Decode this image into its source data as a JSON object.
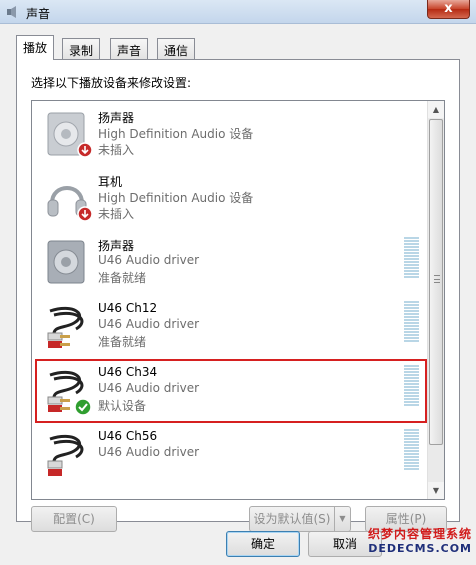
{
  "window": {
    "title": "声音",
    "close_label": "x"
  },
  "tabs": [
    {
      "label": "播放",
      "active": true
    },
    {
      "label": "录制",
      "active": false
    },
    {
      "label": "声音",
      "active": false
    },
    {
      "label": "通信",
      "active": false
    }
  ],
  "playback": {
    "instruction": "选择以下播放设备来修改设置:",
    "devices": [
      {
        "name": "扬声器",
        "description": "High Definition Audio 设备",
        "status": "未插入",
        "icon": "speaker-icon",
        "badge": "unplugged",
        "meter": false
      },
      {
        "name": "耳机",
        "description": "High Definition Audio 设备",
        "status": "未插入",
        "icon": "headphones-icon",
        "badge": "unplugged",
        "meter": false
      },
      {
        "name": "扬声器",
        "description": "U46 Audio driver",
        "status": "准备就绪",
        "icon": "speaker-icon",
        "badge": "none",
        "meter": true
      },
      {
        "name": "U46 Ch12",
        "description": "U46 Audio driver",
        "status": "准备就绪",
        "icon": "rca-cable-icon",
        "badge": "none",
        "meter": true
      },
      {
        "name": "U46 Ch34",
        "description": "U46 Audio driver",
        "status": "默认设备",
        "icon": "rca-cable-icon",
        "badge": "default",
        "meter": true,
        "selected": true
      },
      {
        "name": "U46 Ch56",
        "description": "U46 Audio driver",
        "status": "",
        "icon": "rca-cable-icon",
        "badge": "none",
        "meter": true
      }
    ]
  },
  "buttons": {
    "configure": "配置(C)",
    "set_default": "设为默认值(S)",
    "properties": "属性(P)",
    "ok": "确定",
    "cancel": "取消"
  },
  "watermark": {
    "line1": "织梦内容管理系统",
    "line2": "DEDECMS.COM"
  },
  "colors": {
    "selection_outline": "#d62020",
    "muted_text": "#6d6d6d",
    "meter": "#b9d6e6"
  }
}
